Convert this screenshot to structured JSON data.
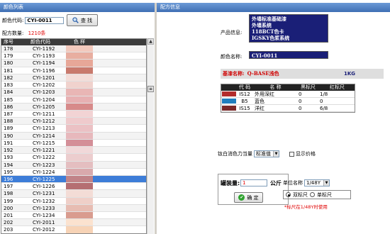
{
  "left_panel": {
    "title": "颜色列表",
    "code_label": "颜色代码:",
    "code_value": "CYI-0011",
    "search_label": "查 找",
    "count_label": "配方数量:",
    "count_value": "1210条",
    "columns": [
      "序号",
      "颜色代码",
      "色 样"
    ],
    "rows": [
      {
        "no": "178",
        "code": "CYI-1192",
        "color": "#f2c9bd"
      },
      {
        "no": "179",
        "code": "CYI-1193",
        "color": "#e8aea0"
      },
      {
        "no": "180",
        "code": "CYI-1194",
        "color": "#e7a798"
      },
      {
        "no": "181",
        "code": "CYI-1196",
        "color": "#c97a6d"
      },
      {
        "no": "182",
        "code": "CYI-1201",
        "color": "#f4ddd8"
      },
      {
        "no": "183",
        "code": "CYI-1202",
        "color": "#f0d2cd"
      },
      {
        "no": "184",
        "code": "CYI-1203",
        "color": "#e9b6b5"
      },
      {
        "no": "185",
        "code": "CYI-1204",
        "color": "#e7b0b2"
      },
      {
        "no": "186",
        "code": "CYI-1205",
        "color": "#d78a8a"
      },
      {
        "no": "187",
        "code": "CYI-1211",
        "color": "#f2d3d4"
      },
      {
        "no": "188",
        "code": "CYI-1212",
        "color": "#efcacc"
      },
      {
        "no": "189",
        "code": "CYI-1213",
        "color": "#ebc1c4"
      },
      {
        "no": "190",
        "code": "CYI-1214",
        "color": "#e7b8bc"
      },
      {
        "no": "191",
        "code": "CYI-1215",
        "color": "#d48f98"
      },
      {
        "no": "192",
        "code": "CYI-1221",
        "color": "#f1d8d9"
      },
      {
        "no": "193",
        "code": "CYI-1222",
        "color": "#eccdce"
      },
      {
        "no": "194",
        "code": "CYI-1223",
        "color": "#e4bec0"
      },
      {
        "no": "195",
        "code": "CYI-1224",
        "color": "#d9a9ac"
      },
      {
        "no": "196",
        "code": "CYI-1225",
        "color": "#c18388",
        "selected": true
      },
      {
        "no": "197",
        "code": "CYI-1226",
        "color": "#b56e72"
      },
      {
        "no": "198",
        "code": "CYI-1231",
        "color": "#f3dcd6"
      },
      {
        "no": "199",
        "code": "CYI-1232",
        "color": "#efcfc8"
      },
      {
        "no": "200",
        "code": "CYI-1233",
        "color": "#e7bcb2"
      },
      {
        "no": "201",
        "code": "CYI-1234",
        "color": "#d99c8f"
      },
      {
        "no": "202",
        "code": "CYI-2011",
        "color": "#fbe2cf"
      },
      {
        "no": "203",
        "code": "CYI-2012",
        "color": "#f7d3b6"
      }
    ]
  },
  "right_panel": {
    "title": "配方信息",
    "product_label": "产品信息:",
    "product_lines": [
      "外墙标准基础漆",
      "外墙系统",
      "118BCT色卡",
      "IGSKY色浆系统"
    ],
    "color_name_label": "颜色名称:",
    "color_name_value": "CYI-0011",
    "base_label": "基漆名称:",
    "base_name": "Q-BASE浅色",
    "base_qty": "1KG",
    "formula_columns": [
      "代 码",
      "名 称",
      "黑标尺",
      "红标尺"
    ],
    "formula_rows": [
      {
        "color": "#b22c2c",
        "code": "IS12",
        "name": "外用深红",
        "black": "0",
        "red": "1/8"
      },
      {
        "color": "#1f7fbf",
        "code": "B5",
        "name": "蓝色",
        "black": "0",
        "red": "0"
      },
      {
        "color": "#7a2a2a",
        "code": "IS15",
        "name": "洋红",
        "black": "0",
        "red": "6/8"
      }
    ],
    "adjust_label": "钛白消色力当量",
    "adjust_value": "标准值",
    "show_price_label": "显示价格",
    "qty_label": "罐装量:",
    "qty_value": "1",
    "qty_unit": "公斤",
    "ok_label": "确 定",
    "unit_label": "单位名称",
    "unit_value": "1/48Y",
    "radio_double": "双标尺",
    "radio_single": "单标尺",
    "note": "*标尺在1/48Y时使用"
  }
}
